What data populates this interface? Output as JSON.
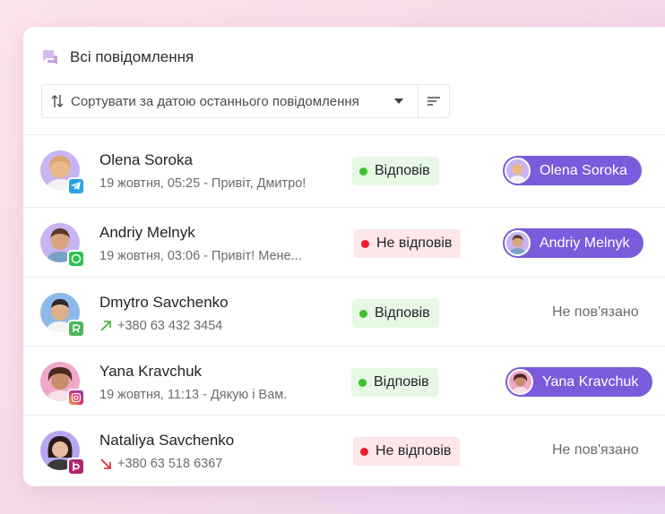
{
  "header": {
    "title": "Всі повідомлення",
    "icon": "chat-bubbles-icon"
  },
  "sort": {
    "label": "Сортувати за датою останнього повідомлення"
  },
  "colors": {
    "accent": "#7a5bdc",
    "answered": "#3cc22a",
    "unanswered": "#ee1d2e"
  },
  "rows": [
    {
      "name": "Olena Soroka",
      "sub": "19 жовтня, 05:25 - Привіт, Дмитро!",
      "channel": "telegram",
      "status": "Відповів",
      "status_type": "answered",
      "link": "Olena Soroka"
    },
    {
      "name": "Andriy Melnyk",
      "sub": "19 жовтня, 03:06 - Привіт! Мене...",
      "channel": "whatsapp",
      "status": "Не відповів",
      "status_type": "unanswered",
      "link": "Andriy Melnyk"
    },
    {
      "name": "Dmytro Savchenko",
      "sub": "+380 63 432 3454",
      "channel": "ringostat",
      "call": "outgoing",
      "status": "Відповів",
      "status_type": "answered",
      "link": "Не пов'язано"
    },
    {
      "name": "Yana Kravchuk",
      "sub": "19 жовтня, 11:13 - Дякую і Вам.",
      "channel": "instagram",
      "status": "Відповів",
      "status_type": "answered",
      "link": "Yana Kravchuk"
    },
    {
      "name": "Nataliya Savchenko",
      "sub": "+380 63 518 6367",
      "channel": "binotel",
      "call": "incoming",
      "status": "Не відповів",
      "status_type": "unanswered",
      "link": "Не пов'язано"
    }
  ]
}
